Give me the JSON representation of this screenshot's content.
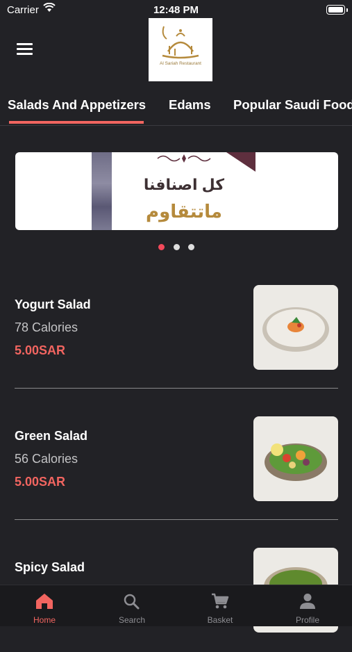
{
  "status_bar": {
    "carrier": "Carrier",
    "time": "12:48 PM"
  },
  "header": {
    "logo_text": "Al Sariah Restaurant"
  },
  "tabs": [
    {
      "label": "Salads And Appetizers",
      "active": true
    },
    {
      "label": "Edams",
      "active": false
    },
    {
      "label": "Popular Saudi Food",
      "active": false
    }
  ],
  "banner": {
    "line1": "كل اصنافنا",
    "line2": "ماتتقاوم"
  },
  "carousel": {
    "pages": 3,
    "active_page": 1
  },
  "menu_items": [
    {
      "name": "Yogurt Salad",
      "calories": "78 Calories",
      "price": "5.00SAR"
    },
    {
      "name": "Green Salad",
      "calories": "56 Calories",
      "price": "5.00SAR"
    },
    {
      "name": "Spicy Salad",
      "calories": "",
      "price": ""
    }
  ],
  "bottom_nav": [
    {
      "label": "Home",
      "icon": "home-icon",
      "active": true
    },
    {
      "label": "Search",
      "icon": "search-icon",
      "active": false
    },
    {
      "label": "Basket",
      "icon": "cart-icon",
      "active": false
    },
    {
      "label": "Profile",
      "icon": "person-icon",
      "active": false
    }
  ],
  "colors": {
    "accent": "#f26560",
    "background": "#222226",
    "nav_background": "#1a1a1d"
  }
}
